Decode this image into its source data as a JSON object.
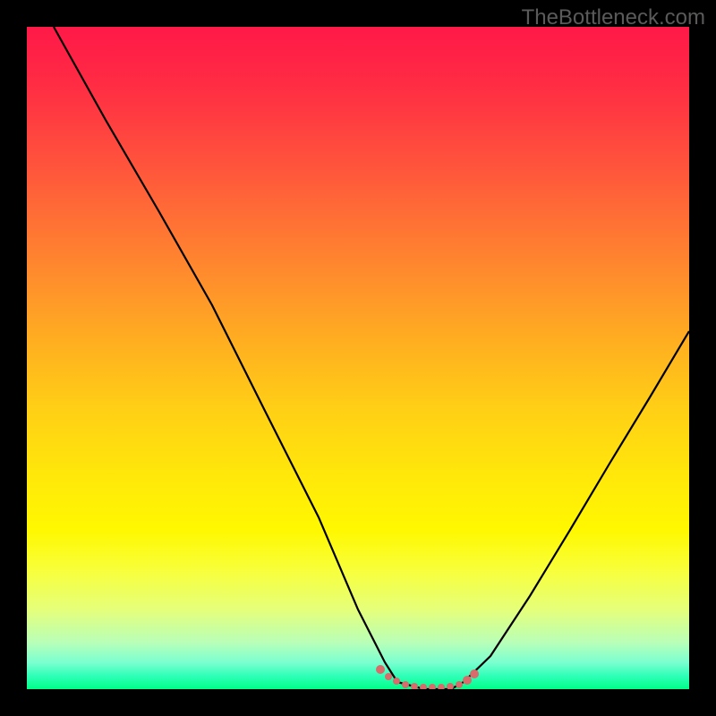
{
  "attribution": "TheBottleneck.com",
  "chart_data": {
    "type": "line",
    "title": "",
    "xlabel": "",
    "ylabel": "",
    "xlim": [
      0,
      100
    ],
    "ylim": [
      0,
      100
    ],
    "curve": {
      "description": "V-shaped bottleneck curve with flat minimum around x=56-66",
      "points": [
        {
          "x": 4,
          "y": 100
        },
        {
          "x": 12,
          "y": 86
        },
        {
          "x": 20,
          "y": 72
        },
        {
          "x": 28,
          "y": 58
        },
        {
          "x": 36,
          "y": 42
        },
        {
          "x": 44,
          "y": 26
        },
        {
          "x": 50,
          "y": 12
        },
        {
          "x": 54,
          "y": 4
        },
        {
          "x": 56,
          "y": 1
        },
        {
          "x": 60,
          "y": 0
        },
        {
          "x": 64,
          "y": 0
        },
        {
          "x": 66,
          "y": 1
        },
        {
          "x": 70,
          "y": 5
        },
        {
          "x": 76,
          "y": 14
        },
        {
          "x": 82,
          "y": 24
        },
        {
          "x": 88,
          "y": 34
        },
        {
          "x": 94,
          "y": 44
        },
        {
          "x": 100,
          "y": 54
        }
      ]
    },
    "highlight_region": {
      "description": "pink dotted marker band at minimum",
      "x_start": 53,
      "x_end": 67,
      "y": 1,
      "color": "#d86b6b"
    },
    "gradient_colors": {
      "top": "#ff1948",
      "mid": "#ffd015",
      "bottom": "#00ff88"
    },
    "grid": false
  }
}
